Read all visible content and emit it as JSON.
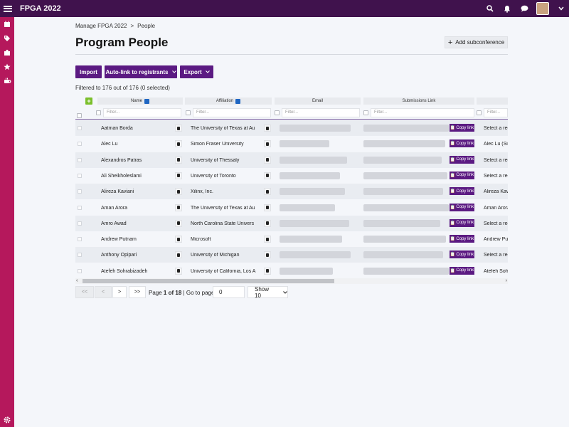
{
  "topbar": {
    "title": "FPGA 2022",
    "icons": [
      "menu-icon",
      "search-icon",
      "bell-icon",
      "chat-icon",
      "user-avatar",
      "chevron-down-icon"
    ]
  },
  "sidebar": {
    "icons": [
      "calendar-icon",
      "tag-icon",
      "puzzle-icon",
      "star-icon",
      "coffee-icon",
      "gear-icon"
    ]
  },
  "breadcrumb": {
    "parent": "Manage FPGA 2022",
    "sep": ">",
    "current": "People"
  },
  "page": {
    "title": "Program People",
    "add_sub": "Add subconference"
  },
  "toolbar": {
    "import": "Import",
    "autolink": "Auto-link to registrants",
    "export": "Export"
  },
  "filtered": "Filtered to 176 out of 176 (0 selected)",
  "columns": {
    "name": "Name",
    "affiliation": "Affiliation",
    "email": "Email",
    "submissions": "Submissions Link"
  },
  "filter_placeholder": "Filter...",
  "copy_label": "Copy link",
  "rows": [
    {
      "name": "Aatman Borda",
      "aff": "The University of Texas at Au",
      "role": "Select a reg"
    },
    {
      "name": "Alec Lu",
      "aff": "Simon Fraser University",
      "role": "Alec Lu (Sin"
    },
    {
      "name": "Alexandros Patras",
      "aff": "University of Thessaly",
      "role": "Select a reg"
    },
    {
      "name": "Ali Sheikholeslami",
      "aff": "University of Toronto",
      "role": "Select a reg"
    },
    {
      "name": "Alireza Kaviani",
      "aff": "Xilinx, Inc.",
      "role": "Alireza Kavi"
    },
    {
      "name": "Aman Arora",
      "aff": "The University of Texas at Au",
      "role": "Aman Arora"
    },
    {
      "name": "Amro Awad",
      "aff": "North Carolina State Univers",
      "role": "Select a reg"
    },
    {
      "name": "Andrew Putnam",
      "aff": "Microsoft",
      "role": "Andrew Put"
    },
    {
      "name": "Anthony Opipari",
      "aff": "University of Michigan",
      "role": "Select a reg"
    },
    {
      "name": "Atefeh Sohrabizadeh",
      "aff": "University of California, Los A",
      "role": "Atefeh Soh"
    }
  ],
  "pagination": {
    "first": "<<",
    "prev": "<",
    "next": ">",
    "last": ">>",
    "page_label": "Page",
    "page": "1",
    "of_label": "of",
    "total": "18",
    "goto": "| Go to page:",
    "goto_value": "0",
    "show": "Show 10"
  }
}
